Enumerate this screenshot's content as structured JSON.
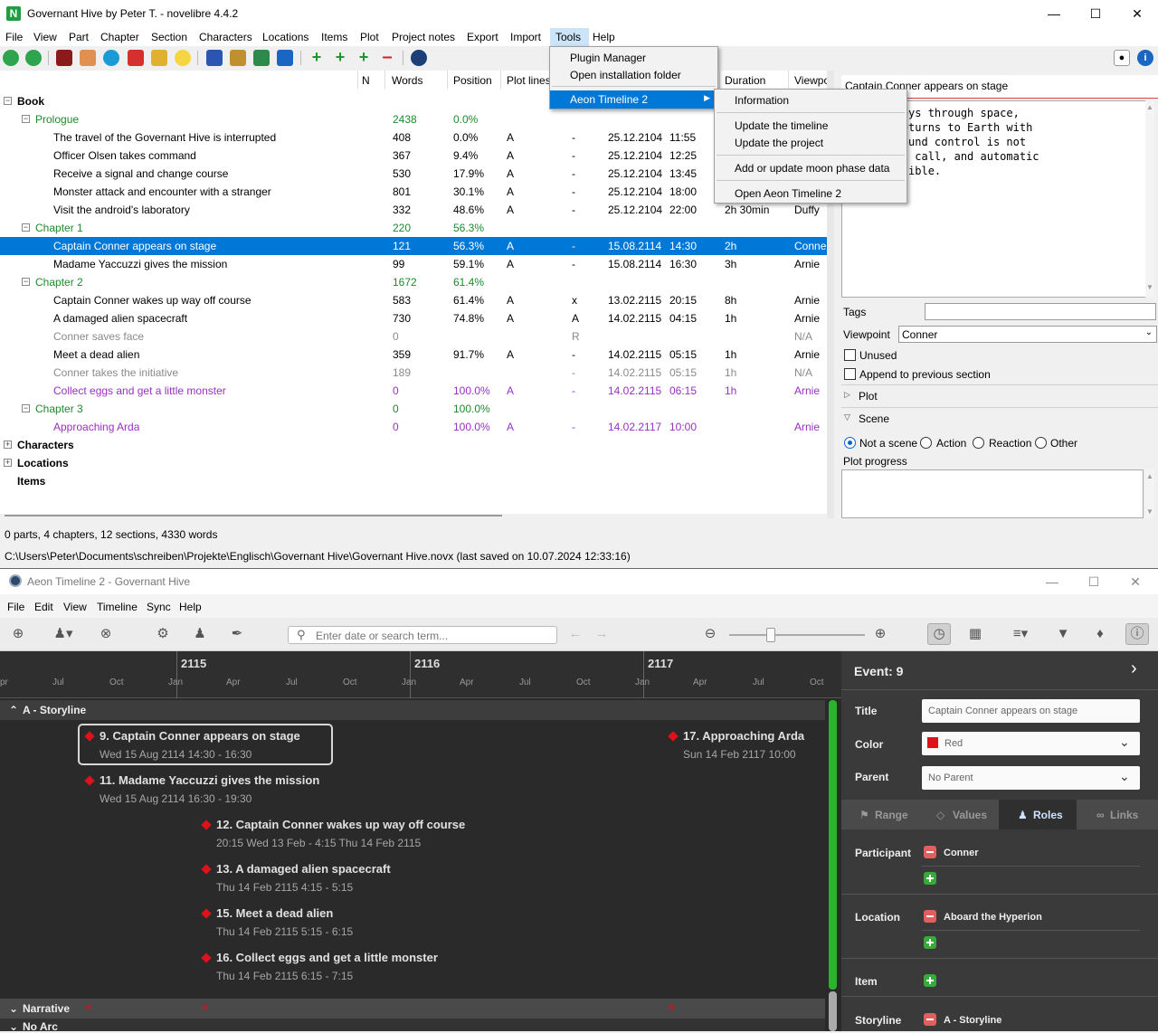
{
  "novelibre": {
    "window_title": "Governant Hive by Peter T. - novelibre 4.4.2",
    "menu": [
      "File",
      "View",
      "Part",
      "Chapter",
      "Section",
      "Characters",
      "Locations",
      "Items",
      "Plot",
      "Project notes",
      "Export",
      "Import",
      "Tools",
      "Help"
    ],
    "columns": {
      "n": "N",
      "words": "Words",
      "position": "Position",
      "plot_lines": "Plot lines",
      "duration": "Duration",
      "viewpoint": "Viewpo"
    },
    "tree": [
      {
        "label": "Book"
      },
      {
        "label": "Prologue",
        "words": "2438",
        "position": "0.0%"
      },
      {
        "label": "The travel of the Governant Hive is interrupted",
        "words": "408",
        "position": "0.0%",
        "plot": "A",
        "tag": "-",
        "date": "25.12.2104",
        "time": "11:55"
      },
      {
        "label": "Officer Olsen takes command",
        "words": "367",
        "position": "9.4%",
        "plot": "A",
        "tag": "-",
        "date": "25.12.2104",
        "time": "12:25"
      },
      {
        "label": "Receive a signal and change course",
        "words": "530",
        "position": "17.9%",
        "plot": "A",
        "tag": "-",
        "date": "25.12.2104",
        "time": "13:45"
      },
      {
        "label": "Monster attack and encounter with a stranger",
        "words": "801",
        "position": "30.1%",
        "plot": "A",
        "tag": "-",
        "date": "25.12.2104",
        "time": "18:00"
      },
      {
        "label": "Visit the android's laboratory",
        "words": "332",
        "position": "48.6%",
        "plot": "A",
        "tag": "-",
        "date": "25.12.2104",
        "time": "22:00",
        "duration": "2h 30min",
        "viewpoint": "Duffy"
      },
      {
        "label": "Chapter 1",
        "words": "220",
        "position": "56.3%"
      },
      {
        "label": "Captain Conner appears on stage",
        "words": "121",
        "position": "56.3%",
        "plot": "A",
        "tag": "-",
        "date": "15.08.2114",
        "time": "14:30",
        "duration": "2h",
        "viewpoint": "Conne"
      },
      {
        "label": "Madame Yaccuzzi gives the mission",
        "words": "99",
        "position": "59.1%",
        "plot": "A",
        "tag": "-",
        "date": "15.08.2114",
        "time": "16:30",
        "duration": "3h",
        "viewpoint": "Arnie"
      },
      {
        "label": "Chapter 2",
        "words": "1672",
        "position": "61.4%"
      },
      {
        "label": "Captain Conner wakes up way off course",
        "words": "583",
        "position": "61.4%",
        "plot": "A",
        "tag": "x",
        "date": "13.02.2115",
        "time": "20:15",
        "duration": "8h",
        "viewpoint": "Arnie"
      },
      {
        "label": "A damaged alien spacecraft",
        "words": "730",
        "position": "74.8%",
        "plot": "A",
        "tag": "A",
        "date": "14.02.2115",
        "time": "04:15",
        "duration": "1h",
        "viewpoint": "Arnie"
      },
      {
        "label": "Conner saves face",
        "words": "0",
        "tag": "R",
        "viewpoint": "N/A"
      },
      {
        "label": "Meet a dead alien",
        "words": "359",
        "position": "91.7%",
        "plot": "A",
        "tag": "-",
        "date": "14.02.2115",
        "time": "05:15",
        "duration": "1h",
        "viewpoint": "Arnie"
      },
      {
        "label": "Conner takes the initiative",
        "words": "189",
        "tag": "-",
        "date": "14.02.2115",
        "time": "05:15",
        "duration": "1h",
        "viewpoint": "N/A"
      },
      {
        "label": "Collect eggs and get a little monster",
        "words": "0",
        "position": "100.0%",
        "plot": "A",
        "tag": "-",
        "date": "14.02.2115",
        "time": "06:15",
        "duration": "1h",
        "viewpoint": "Arnie"
      },
      {
        "label": "Chapter 3",
        "words": "0",
        "position": "100.0%"
      },
      {
        "label": "Approaching Arda",
        "words": "0",
        "position": "100.0%",
        "plot": "A",
        "tag": "-",
        "date": "14.02.2117",
        "time": "10:00",
        "viewpoint": "Arnie"
      },
      {
        "label": "Characters"
      },
      {
        "label": "Locations"
      },
      {
        "label": "Items"
      }
    ],
    "status_counts": "0 parts, 4 chapters, 12 sections, 4330 words",
    "status_path": "C:\\Users\\Peter\\Documents\\schreiben\\Projekte\\Englisch\\Governant Hive\\Governant Hive.novx (last saved on 10.07.2024 12:33:16)",
    "tools_menu": [
      "Plugin Manager",
      "Open installation folder",
      "Aeon Timeline 2"
    ],
    "aeon_submenu": [
      "Information",
      "Update the timeline",
      "Update the project",
      "Add or update moon phase data",
      "Open Aeon Timeline 2"
    ],
    "section_panel": {
      "title": "Captain Conner appears on stage",
      "description": "ng journeys through space,\nConner returns to Earth with\nrion. Ground control is not\nng to his call, and automatic\nis impossible.",
      "tags_label": "Tags",
      "viewpoint_label": "Viewpoint",
      "viewpoint_value": "Conner",
      "unused_label": "Unused",
      "append_label": "Append to previous section",
      "plot_label": "Plot",
      "scene_label": "Scene",
      "scene_options": [
        "Not a scene",
        "Action",
        "Reaction",
        "Other"
      ],
      "plot_progress_label": "Plot progress"
    }
  },
  "aeon": {
    "window_title": "Aeon Timeline 2 - Governant Hive",
    "menu": [
      "File",
      "Edit",
      "View",
      "Timeline",
      "Sync",
      "Help"
    ],
    "search_placeholder": "Enter date or search term...",
    "years": [
      "2115",
      "2116",
      "2117"
    ],
    "months": [
      "pr",
      "Jul",
      "Oct",
      "Jan",
      "Apr",
      "Jul",
      "Oct",
      "Jan",
      "Apr",
      "Jul",
      "Oct",
      "Jan",
      "Apr",
      "Jul",
      "Oct"
    ],
    "groups": {
      "storyline": "A - Storyline",
      "narrative": "Narrative",
      "noarc": "No Arc"
    },
    "events": [
      {
        "title": "9. Captain Conner appears on stage",
        "date": "Wed 15 Aug 2114 14:30 - 16:30"
      },
      {
        "title": "11. Madame Yaccuzzi gives the mission",
        "date": "Wed 15 Aug 2114 16:30 - 19:30"
      },
      {
        "title": "12. Captain Conner wakes up way off course",
        "date": "20:15 Wed 13 Feb - 4:15 Thu 14 Feb 2115"
      },
      {
        "title": "13. A damaged alien spacecraft",
        "date": "Thu 14 Feb 2115 4:15 - 5:15"
      },
      {
        "title": "15. Meet a dead alien",
        "date": "Thu 14 Feb 2115 5:15 - 6:15"
      },
      {
        "title": "16. Collect eggs and get a little monster",
        "date": "Thu 14 Feb 2115 6:15 - 7:15"
      },
      {
        "title": "17. Approaching Arda",
        "date": "Sun 14 Feb 2117 10:00"
      }
    ],
    "inspector": {
      "header": "Event: 9",
      "title_label": "Title",
      "title_value": "Captain Conner appears on stage",
      "color_label": "Color",
      "color_value": "Red",
      "color_hex": "#e0111a",
      "parent_label": "Parent",
      "parent_value": "No Parent",
      "tabs": [
        "Range",
        "Values",
        "Roles",
        "Links"
      ],
      "roles": [
        {
          "label": "Participant",
          "value": "Conner"
        },
        {
          "label": "Location",
          "value": "Aboard the Hyperion"
        },
        {
          "label": "Item",
          "value": ""
        },
        {
          "label": "Storyline",
          "value": "A - Storyline"
        }
      ]
    }
  }
}
